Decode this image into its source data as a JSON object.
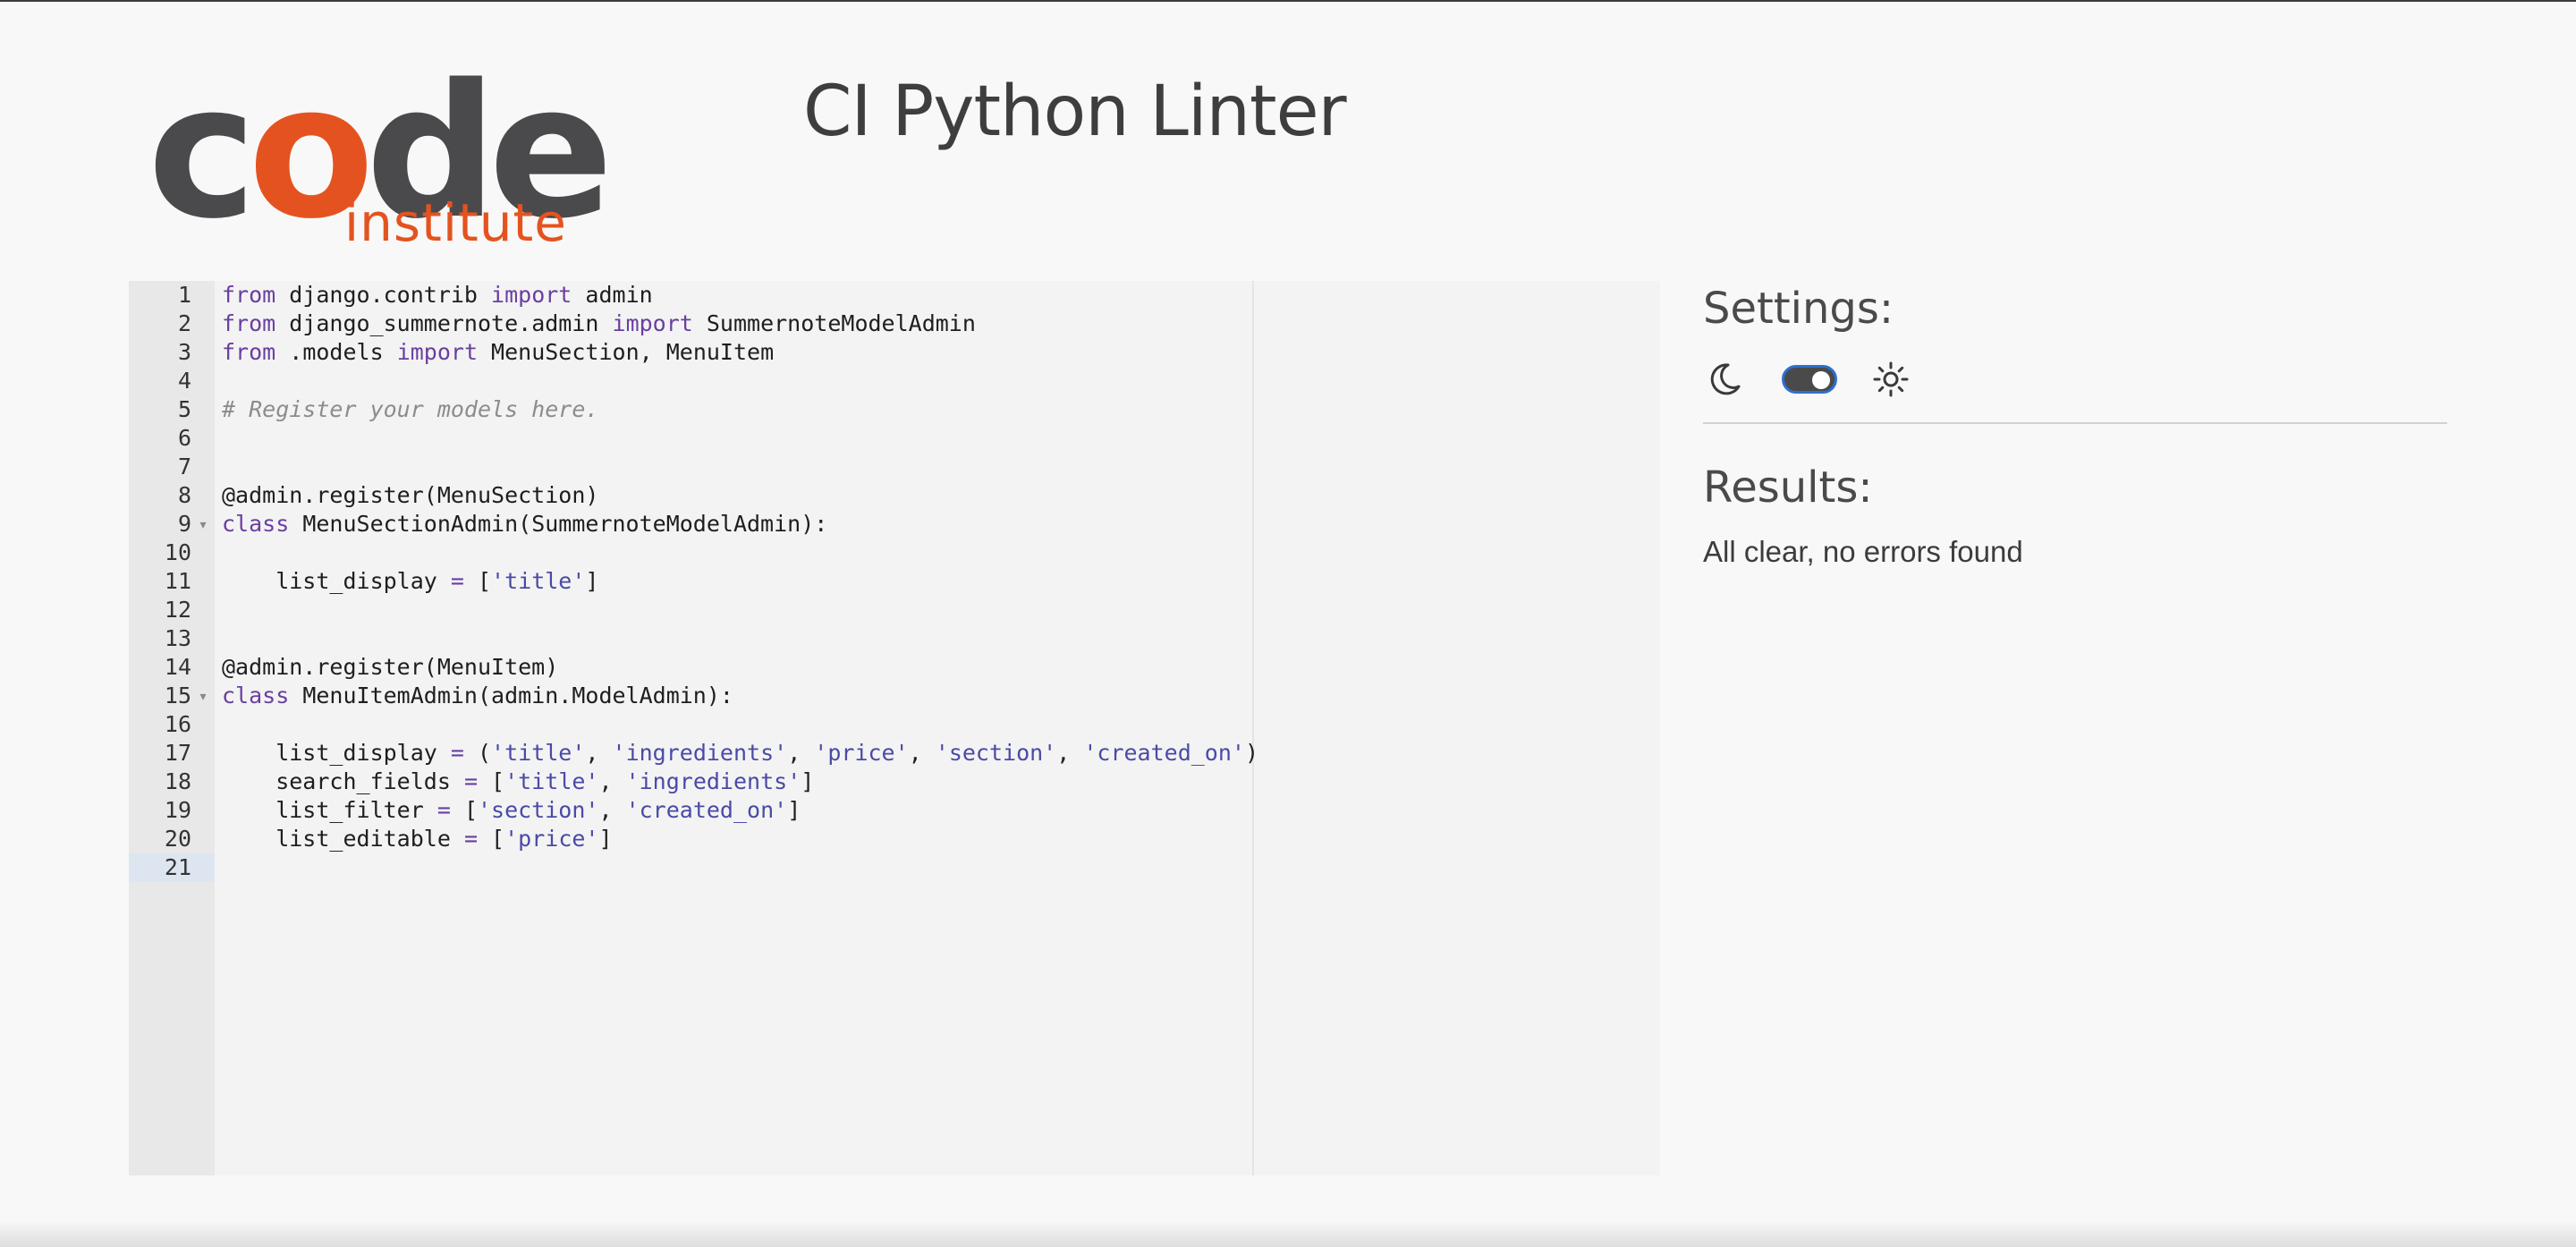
{
  "header": {
    "logo_word": "code",
    "logo_sub": "institute",
    "title": "CI Python Linter"
  },
  "editor": {
    "lines": [
      {
        "n": "1",
        "fold": false,
        "tokens": [
          [
            "kw",
            "from"
          ],
          [
            "t",
            " django.contrib "
          ],
          [
            "kw",
            "import"
          ],
          [
            "t",
            " admin"
          ]
        ]
      },
      {
        "n": "2",
        "fold": false,
        "tokens": [
          [
            "kw",
            "from"
          ],
          [
            "t",
            " django_summernote.admin "
          ],
          [
            "kw",
            "import"
          ],
          [
            "t",
            " SummernoteModelAdmin"
          ]
        ]
      },
      {
        "n": "3",
        "fold": false,
        "tokens": [
          [
            "kw",
            "from"
          ],
          [
            "t",
            " .models "
          ],
          [
            "kw",
            "import"
          ],
          [
            "t",
            " MenuSection, MenuItem"
          ]
        ]
      },
      {
        "n": "4",
        "fold": false,
        "tokens": []
      },
      {
        "n": "5",
        "fold": false,
        "tokens": [
          [
            "cm",
            "# Register your models here."
          ]
        ]
      },
      {
        "n": "6",
        "fold": false,
        "tokens": []
      },
      {
        "n": "7",
        "fold": false,
        "tokens": []
      },
      {
        "n": "8",
        "fold": false,
        "tokens": [
          [
            "t",
            "@admin.register(MenuSection)"
          ]
        ]
      },
      {
        "n": "9",
        "fold": true,
        "tokens": [
          [
            "kw",
            "class"
          ],
          [
            "t",
            " MenuSectionAdmin(SummernoteModelAdmin):"
          ]
        ]
      },
      {
        "n": "10",
        "fold": false,
        "tokens": []
      },
      {
        "n": "11",
        "fold": false,
        "tokens": [
          [
            "t",
            "    list_display "
          ],
          [
            "op",
            "="
          ],
          [
            "t",
            " ["
          ],
          [
            "str",
            "'title'"
          ],
          [
            "t",
            "]"
          ]
        ]
      },
      {
        "n": "12",
        "fold": false,
        "tokens": []
      },
      {
        "n": "13",
        "fold": false,
        "tokens": []
      },
      {
        "n": "14",
        "fold": false,
        "tokens": [
          [
            "t",
            "@admin.register(MenuItem)"
          ]
        ]
      },
      {
        "n": "15",
        "fold": true,
        "tokens": [
          [
            "kw",
            "class"
          ],
          [
            "t",
            " MenuItemAdmin(admin.ModelAdmin):"
          ]
        ]
      },
      {
        "n": "16",
        "fold": false,
        "tokens": []
      },
      {
        "n": "17",
        "fold": false,
        "tokens": [
          [
            "t",
            "    list_display "
          ],
          [
            "op",
            "="
          ],
          [
            "t",
            " ("
          ],
          [
            "str",
            "'title'"
          ],
          [
            "t",
            ", "
          ],
          [
            "str",
            "'ingredients'"
          ],
          [
            "t",
            ", "
          ],
          [
            "str",
            "'price'"
          ],
          [
            "t",
            ", "
          ],
          [
            "str",
            "'section'"
          ],
          [
            "t",
            ", "
          ],
          [
            "str",
            "'created_on'"
          ],
          [
            "t",
            ")"
          ]
        ]
      },
      {
        "n": "18",
        "fold": false,
        "tokens": [
          [
            "t",
            "    search_fields "
          ],
          [
            "op",
            "="
          ],
          [
            "t",
            " ["
          ],
          [
            "str",
            "'title'"
          ],
          [
            "t",
            ", "
          ],
          [
            "str",
            "'ingredients'"
          ],
          [
            "t",
            "]"
          ]
        ]
      },
      {
        "n": "19",
        "fold": false,
        "tokens": [
          [
            "t",
            "    list_filter "
          ],
          [
            "op",
            "="
          ],
          [
            "t",
            " ["
          ],
          [
            "str",
            "'section'"
          ],
          [
            "t",
            ", "
          ],
          [
            "str",
            "'created_on'"
          ],
          [
            "t",
            "]"
          ]
        ]
      },
      {
        "n": "20",
        "fold": false,
        "tokens": [
          [
            "t",
            "    list_editable "
          ],
          [
            "op",
            "="
          ],
          [
            "t",
            " ["
          ],
          [
            "str",
            "'price'"
          ],
          [
            "t",
            "]"
          ]
        ]
      },
      {
        "n": "21",
        "fold": false,
        "active": true,
        "tokens": []
      }
    ]
  },
  "settings": {
    "title": "Settings:",
    "dark_icon": "moon-icon",
    "light_icon": "sun-icon",
    "theme_toggle_on": true
  },
  "results": {
    "title": "Results:",
    "message": "All clear, no errors found"
  },
  "colors": {
    "brand_orange": "#e4531f",
    "logo_grey": "#4a4a4c",
    "toggle_focus": "#2e6fd0"
  }
}
